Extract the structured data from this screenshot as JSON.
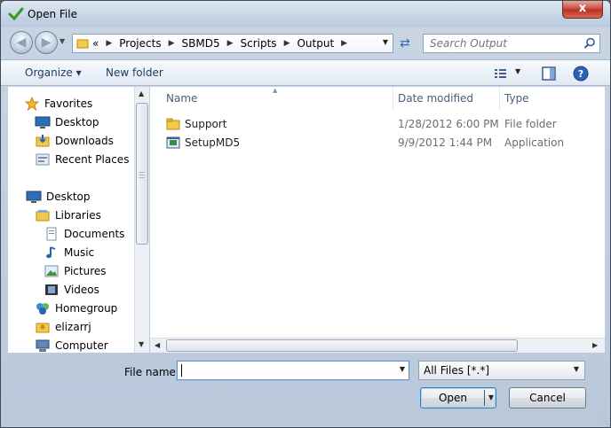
{
  "window": {
    "title": "Open File",
    "close_glyph": "x",
    "icon": "green-check-icon"
  },
  "nav": {
    "back_icon": "back-arrow-icon",
    "forward_icon": "forward-arrow-icon",
    "breadcrumb": [
      "«",
      "Projects",
      "SBMD5",
      "Scripts",
      "Output"
    ],
    "search_placeholder": "Search Output"
  },
  "toolbar": {
    "organize_label": "Organize ▾",
    "new_folder_label": "New folder"
  },
  "sidebar": {
    "favorites_label": "Favorites",
    "favorites": [
      "Desktop",
      "Downloads",
      "Recent Places"
    ],
    "desktop_label": "Desktop",
    "libraries_label": "Libraries",
    "libraries": [
      "Documents",
      "Music",
      "Pictures",
      "Videos"
    ],
    "homegroup_label": "Homegroup",
    "user_label": "elizarrj",
    "computer_label": "Computer"
  },
  "files": {
    "columns": [
      "Name",
      "Date modified",
      "Type"
    ],
    "rows": [
      {
        "name": "Support",
        "date": "1/28/2012 6:00 PM",
        "type": "File folder",
        "icon": "folder-icon"
      },
      {
        "name": "SetupMD5",
        "date": "9/9/2012 1:44 PM",
        "type": "Application",
        "icon": "application-icon"
      }
    ]
  },
  "footer": {
    "file_name_label": "File name:",
    "file_name_value": "",
    "file_type_value": "All Files [*.*]",
    "open_label": "Open",
    "cancel_label": "Cancel"
  },
  "colors": {
    "accent": "#3c7fb1",
    "folder": "#f2c94c",
    "window_frame": "#c4d3e4"
  }
}
